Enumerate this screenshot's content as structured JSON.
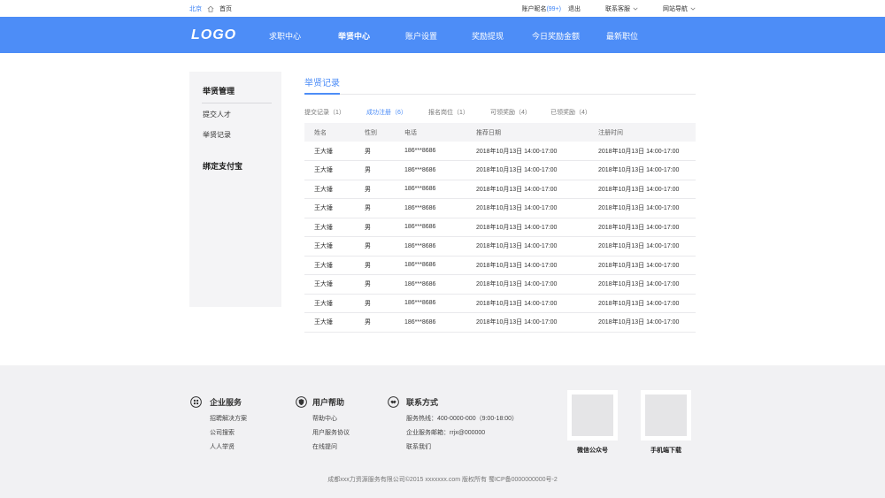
{
  "topbar": {
    "city": "北京",
    "home": "首页",
    "account": "账户昵名",
    "count": "(99+)",
    "logout": "退出",
    "service": "联系客服",
    "sitenav": "网站导航"
  },
  "nav": {
    "logo": "LOGO",
    "items": [
      "求职中心",
      "举贤中心",
      "账户设置",
      "奖励提现",
      "今日奖励金额",
      "最新职位"
    ],
    "active": "举贤中心"
  },
  "sidebar": {
    "group1": "举贤管理",
    "sub1": "提交人才",
    "sub2": "举贤记录",
    "group2": "绑定支付宝"
  },
  "content": {
    "heading": "举贤记录",
    "tabs": [
      "提交记录（1）",
      "成功注册（6）",
      "报名岗位（1）",
      "可领奖励（4）",
      "已领奖励（4）"
    ],
    "active_tab": "成功注册（6）",
    "columns": [
      "姓名",
      "性别",
      "电话",
      "推荐日期",
      "注册时间"
    ],
    "rows": [
      [
        "王大锤",
        "男",
        "186***8686",
        "2018年10月13日 14:00-17:00",
        "2018年10月13日 14:00-17:00"
      ],
      [
        "王大锤",
        "男",
        "186***8686",
        "2018年10月13日 14:00-17:00",
        "2018年10月13日 14:00-17:00"
      ],
      [
        "王大锤",
        "男",
        "186***8686",
        "2018年10月13日 14:00-17:00",
        "2018年10月13日 14:00-17:00"
      ],
      [
        "王大锤",
        "男",
        "186***8686",
        "2018年10月13日 14:00-17:00",
        "2018年10月13日 14:00-17:00"
      ],
      [
        "王大锤",
        "男",
        "186***8686",
        "2018年10月13日 14:00-17:00",
        "2018年10月13日 14:00-17:00"
      ],
      [
        "王大锤",
        "男",
        "186***8686",
        "2018年10月13日 14:00-17:00",
        "2018年10月13日 14:00-17:00"
      ],
      [
        "王大锤",
        "男",
        "186***8686",
        "2018年10月13日 14:00-17:00",
        "2018年10月13日 14:00-17:00"
      ],
      [
        "王大锤",
        "男",
        "186***8686",
        "2018年10月13日 14:00-17:00",
        "2018年10月13日 14:00-17:00"
      ],
      [
        "王大锤",
        "男",
        "186***8686",
        "2018年10月13日 14:00-17:00",
        "2018年10月13日 14:00-17:00"
      ],
      [
        "王大锤",
        "男",
        "186***8686",
        "2018年10月13日 14:00-17:00",
        "2018年10月13日 14:00-17:00"
      ]
    ]
  },
  "footer": {
    "col1": {
      "title": "企业服务",
      "icon": "grid-icon",
      "links": [
        "招聘解决方案",
        "公司搜索",
        "人人举贤"
      ]
    },
    "col2": {
      "title": "用户帮助",
      "icon": "shield-icon",
      "links": [
        "帮助中心",
        "用户服务协议",
        "在线提问"
      ]
    },
    "col3": {
      "title": "联系方式",
      "icon": "handshake-icon",
      "links": [
        "服务热线：400-0000-000（9:00-18:00）",
        "企业服务邮箱：rrjx@000000",
        "联系我们"
      ]
    },
    "qr1": "微信公众号",
    "qr2": "手机端下载",
    "copyright": "成都xxx力资源服务有限公司©2015 xxxxxxx.com    版权所有    蜀ICP备0000000000号-2"
  },
  "colors": {
    "brand": "#4d8df7",
    "page_bg": "#f1f1f3"
  }
}
